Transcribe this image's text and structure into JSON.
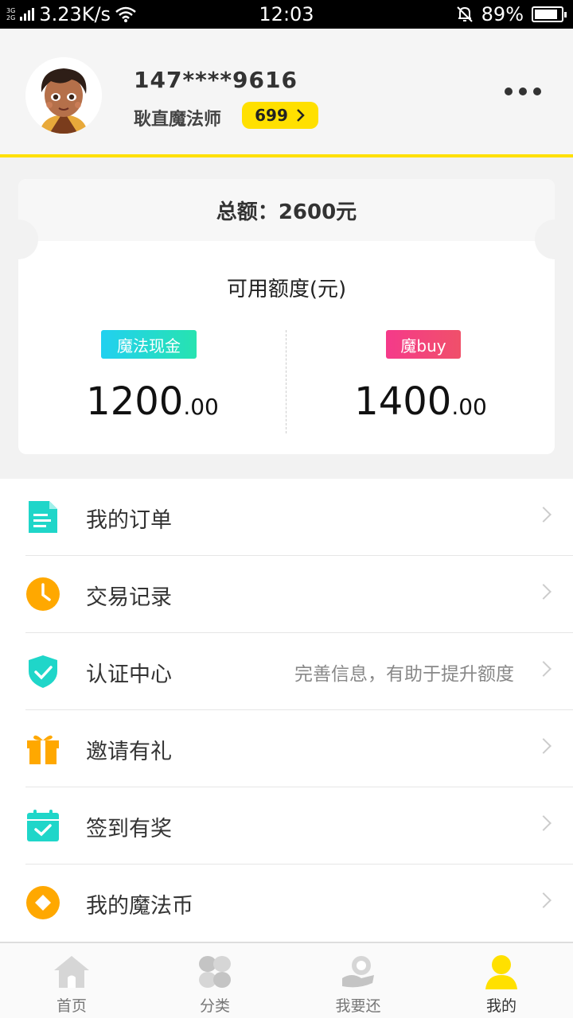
{
  "status_bar": {
    "net_top": "3G",
    "net_bottom": "2G",
    "speed": "3.23K/s",
    "time": "12:03",
    "battery": "89%",
    "battery_level": 0.89
  },
  "profile": {
    "phone": "147****9616",
    "nickname": "耿直魔法师",
    "score": "699"
  },
  "total_card": {
    "total_label": "总额：",
    "total_value": "2600元",
    "available_title": "可用额度(元)",
    "cash_tag": "魔法现金",
    "cash_int": "1200",
    "cash_dec": ".00",
    "buy_tag": "魔buy",
    "buy_int": "1400",
    "buy_dec": ".00"
  },
  "menu": [
    {
      "label": "我的订单",
      "hint": "",
      "icon": "document-icon",
      "color": "#1fd6c9"
    },
    {
      "label": "交易记录",
      "hint": "",
      "icon": "clock-icon",
      "color": "#ffa800"
    },
    {
      "label": "认证中心",
      "hint": "完善信息，有助于提升额度",
      "icon": "shield-check-icon",
      "color": "#1fd6c9"
    },
    {
      "label": "邀请有礼",
      "hint": "",
      "icon": "gift-icon",
      "color": "#ffa800"
    },
    {
      "label": "签到有奖",
      "hint": "",
      "icon": "calendar-check-icon",
      "color": "#1fd6c9"
    },
    {
      "label": "我的魔法币",
      "hint": "",
      "icon": "coin-icon",
      "color": "#ffa800"
    }
  ],
  "tabs": [
    {
      "label": "首页",
      "icon": "home-icon",
      "active": false
    },
    {
      "label": "分类",
      "icon": "category-icon",
      "active": false
    },
    {
      "label": "我要还",
      "icon": "repay-icon",
      "active": false
    },
    {
      "label": "我的",
      "icon": "user-icon",
      "active": true
    }
  ],
  "colors": {
    "accent_yellow": "#ffe000",
    "teal": "#1fd6c9",
    "orange": "#ffa800",
    "pink": "#f53a8a"
  }
}
